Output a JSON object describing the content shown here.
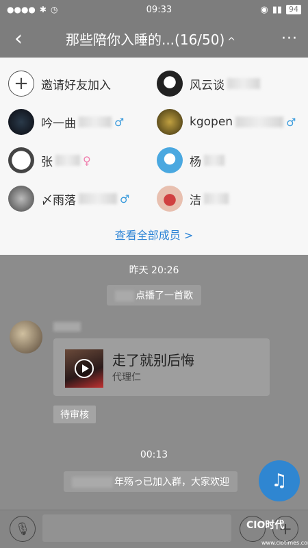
{
  "status_bar": {
    "time": "09:33",
    "battery": "94"
  },
  "header": {
    "title": "那些陪你入睡的...(16/50)",
    "caret": "^",
    "back_icon": "‹",
    "more_icon": "···"
  },
  "members": {
    "items": [
      {
        "name": "邀请好友加入",
        "gender": "",
        "type": "invite"
      },
      {
        "name": "风云谈",
        "gender": "",
        "type": "member"
      },
      {
        "name": "吟一曲",
        "gender": "♂",
        "type": "member"
      },
      {
        "name": "kgopen",
        "gender": "♂",
        "type": "member"
      },
      {
        "name": "张",
        "gender": "♀",
        "type": "member"
      },
      {
        "name": "杨",
        "gender": "",
        "type": "member"
      },
      {
        "name": "〆雨落",
        "gender": "♂",
        "type": "member"
      },
      {
        "name": "洁",
        "gender": "",
        "type": "member"
      }
    ],
    "view_all": "查看全部成员 >"
  },
  "chat": {
    "time_1": "昨天 20:26",
    "system_msg_1": "点播了一首歌",
    "song": {
      "title": "走了就别后悔",
      "artist": "代理仁"
    },
    "pending_label": "待审核",
    "time_2": "00:13",
    "system_msg_2": "年殇っ已加入群，大家欢迎"
  },
  "input": {
    "placeholder": ""
  },
  "watermark": {
    "text": "CIO时代",
    "sub": "www.ciotimes.com"
  },
  "colors": {
    "accent": "#2f86d1",
    "male": "#3a9bdc",
    "female": "#f07fae"
  }
}
